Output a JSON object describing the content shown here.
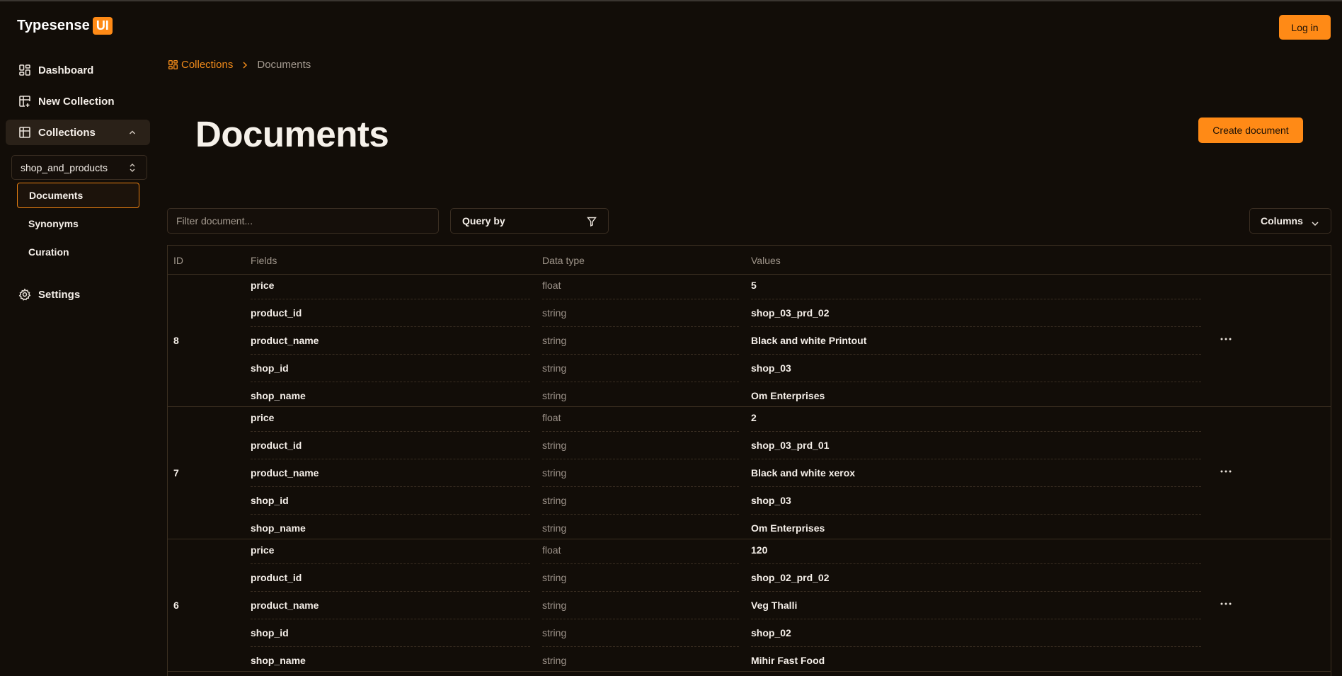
{
  "app": {
    "name": "Typesense",
    "badge": "UI"
  },
  "sidebar": {
    "nav": [
      {
        "label": "Dashboard",
        "icon": "dashboard-icon"
      },
      {
        "label": "New Collection",
        "icon": "table-plus-icon"
      },
      {
        "label": "Collections",
        "icon": "table-icon"
      }
    ],
    "collection_select": "shop_and_products",
    "subitems": [
      {
        "label": "Documents"
      },
      {
        "label": "Synonyms"
      },
      {
        "label": "Curation"
      }
    ],
    "settings": "Settings"
  },
  "header": {
    "login": "Log in"
  },
  "breadcrumb": {
    "root": "Collections",
    "current": "Documents"
  },
  "page": {
    "title": "Documents",
    "create_button": "Create document"
  },
  "toolbar": {
    "filter_placeholder": "Filter document...",
    "query_by": "Query by",
    "columns": "Columns"
  },
  "table": {
    "headers": [
      "ID",
      "Fields",
      "Data type",
      "Values"
    ],
    "documents": [
      {
        "id": "8",
        "fields": [
          {
            "name": "price",
            "type": "float",
            "value": "5"
          },
          {
            "name": "product_id",
            "type": "string",
            "value": "shop_03_prd_02"
          },
          {
            "name": "product_name",
            "type": "string",
            "value": "Black and white Printout"
          },
          {
            "name": "shop_id",
            "type": "string",
            "value": "shop_03"
          },
          {
            "name": "shop_name",
            "type": "string",
            "value": "Om Enterprises"
          }
        ]
      },
      {
        "id": "7",
        "fields": [
          {
            "name": "price",
            "type": "float",
            "value": "2"
          },
          {
            "name": "product_id",
            "type": "string",
            "value": "shop_03_prd_01"
          },
          {
            "name": "product_name",
            "type": "string",
            "value": "Black and white xerox"
          },
          {
            "name": "shop_id",
            "type": "string",
            "value": "shop_03"
          },
          {
            "name": "shop_name",
            "type": "string",
            "value": "Om Enterprises"
          }
        ]
      },
      {
        "id": "6",
        "fields": [
          {
            "name": "price",
            "type": "float",
            "value": "120"
          },
          {
            "name": "product_id",
            "type": "string",
            "value": "shop_02_prd_02"
          },
          {
            "name": "product_name",
            "type": "string",
            "value": "Veg Thalli"
          },
          {
            "name": "shop_id",
            "type": "string",
            "value": "shop_02"
          },
          {
            "name": "shop_name",
            "type": "string",
            "value": "Mihir Fast Food"
          }
        ]
      }
    ]
  },
  "colors": {
    "accent": "#ff8a16",
    "background": "#120d08",
    "border": "#3b2f21"
  }
}
